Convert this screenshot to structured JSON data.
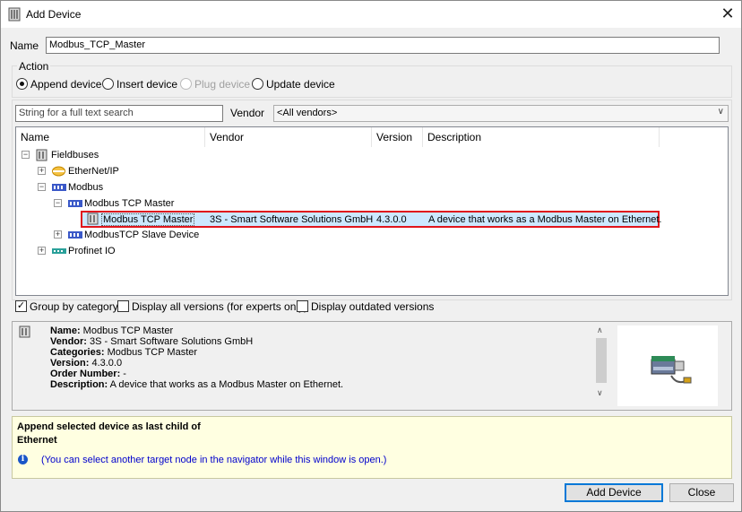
{
  "window": {
    "title": "Add Device",
    "close_glyph": "✕"
  },
  "name_field": {
    "label": "Name",
    "value": "Modbus_TCP_Master"
  },
  "action": {
    "legend": "Action",
    "options": [
      {
        "label": "Append device",
        "selected": true,
        "enabled": true
      },
      {
        "label": "Insert device",
        "selected": false,
        "enabled": true
      },
      {
        "label": "Plug device",
        "selected": false,
        "enabled": false
      },
      {
        "label": "Update device",
        "selected": false,
        "enabled": true
      }
    ]
  },
  "search": {
    "placeholder": "String for a full text search",
    "vendor_label": "Vendor",
    "vendor_value": "<All vendors>"
  },
  "table": {
    "columns": [
      "Name",
      "Vendor",
      "Version",
      "Description"
    ],
    "tree": [
      {
        "label": "Fieldbuses",
        "icon": "device-icon"
      },
      {
        "label": "EtherNet/IP",
        "icon": "ethernet-ip-icon"
      },
      {
        "label": "Modbus",
        "icon": "modbus-icon"
      },
      {
        "label": "Modbus TCP Master",
        "icon": "modbus-icon"
      },
      {
        "label": "Modbus TCP Master",
        "icon": "device-icon",
        "vendor": "3S - Smart Software Solutions GmbH",
        "version": "4.3.0.0",
        "description": "A device that works as a Modbus Master on Ethernet."
      },
      {
        "label": "ModbusTCP Slave Device",
        "icon": "modbus-icon"
      },
      {
        "label": "Profinet IO",
        "icon": "profinet-icon"
      }
    ]
  },
  "options": {
    "group_by_category": {
      "label": "Group by category",
      "checked": true
    },
    "display_all_versions": {
      "label": "Display all versions (for experts only)",
      "checked": false
    },
    "display_outdated": {
      "label": "Display outdated versions",
      "checked": false
    }
  },
  "info": {
    "name_key": "Name:",
    "name_val": " Modbus TCP Master",
    "vendor_key": "Vendor:",
    "vendor_val": " 3S - Smart Software Solutions GmbH",
    "categories_key": "Categories:",
    "categories_val": " Modbus TCP Master",
    "version_key": "Version:",
    "version_val": " 4.3.0.0",
    "order_key": "Order Number:",
    "order_val": " -",
    "description_key": "Description:",
    "description_val": " A device that works as a Modbus Master on Ethernet."
  },
  "message": {
    "line1": "Append selected device as last child of",
    "line2": "Ethernet",
    "hint": "(You can select another target node in the navigator while this window is open.)"
  },
  "buttons": {
    "add": "Add Device",
    "close": "Close"
  },
  "colors": {
    "selection": "#cce8ff",
    "highlight_border": "#e0151c",
    "message_bg": "#ffffe1",
    "hint_text": "#0000cc"
  }
}
